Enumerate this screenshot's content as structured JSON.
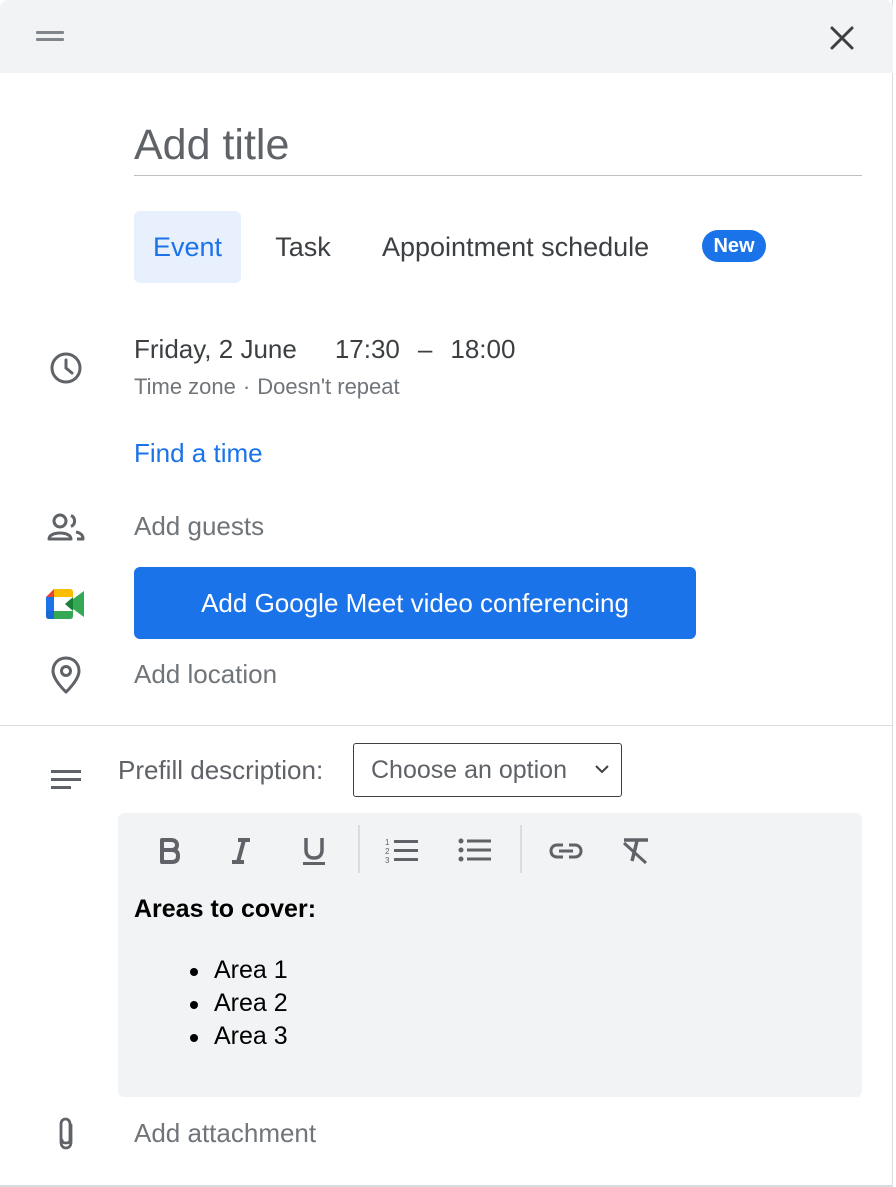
{
  "dialog": {
    "close_label": "close"
  },
  "title": {
    "placeholder": "Add title"
  },
  "tabs": [
    {
      "label": "Event",
      "selected": true
    },
    {
      "label": "Task",
      "selected": false
    },
    {
      "label": "Appointment schedule",
      "selected": false,
      "badge": "New"
    }
  ],
  "datetime": {
    "date": "Friday, 2 June",
    "start": "17:30",
    "separator": "–",
    "end": "18:00",
    "timezone": "Time zone",
    "dot": "·",
    "repeat": "Doesn't repeat"
  },
  "find_time": "Find a time",
  "guests": {
    "placeholder": "Add guests"
  },
  "meet": {
    "label": "Add Google Meet video conferencing"
  },
  "location": {
    "placeholder": "Add location"
  },
  "description": {
    "prefill_label": "Prefill description:",
    "select_value": "Choose an option",
    "heading": "Areas to cover:",
    "items": [
      "Area 1",
      "Area 2",
      "Area 3"
    ]
  },
  "attachment": {
    "label": "Add attachment"
  },
  "icons": {
    "drag": "drag-handle-icon",
    "close": "close-icon",
    "clock": "clock-icon",
    "guests": "people-icon",
    "meet": "google-meet-icon",
    "location": "location-pin-icon",
    "description": "notes-icon",
    "attachment": "paperclip-icon"
  },
  "colors": {
    "accent": "#1a73e8",
    "selected_tab_bg": "#e8f0fe",
    "header_bg": "#f1f3f4",
    "editor_bg": "#f1f3f4"
  }
}
